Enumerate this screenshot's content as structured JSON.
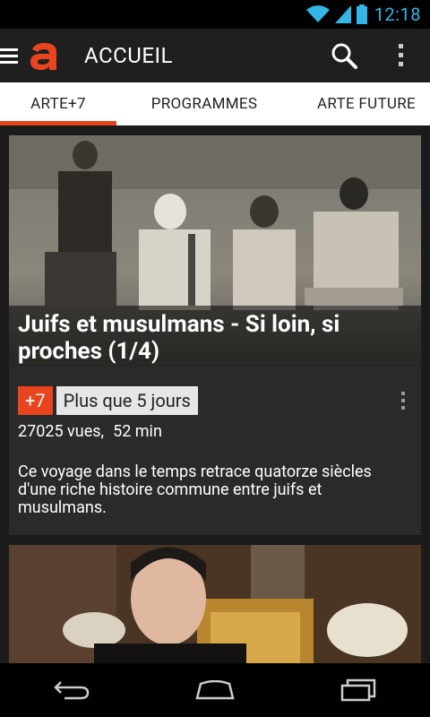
{
  "status": {
    "time": "12:18"
  },
  "appbar": {
    "title": "ACCUEIL",
    "logo_letter": "a"
  },
  "tabs": [
    {
      "label": "ARTE+7",
      "active": true
    },
    {
      "label": "PROGRAMMES",
      "active": false
    },
    {
      "label": "ARTE FUTURE",
      "active": false
    }
  ],
  "cards": [
    {
      "title": "Juifs et musulmans - Si loin, si proches  (1/4)",
      "badge": "+7",
      "availability": "Plus que 5 jours",
      "views": "27025 vues,",
      "duration": "52 min",
      "description": "Ce voyage dans le temps retrace quatorze siècles d'une riche histoire commune entre juifs et musulmans."
    }
  ],
  "colors": {
    "accent": "#e8451f",
    "status_blue": "#33b5e5",
    "card_bg": "#2a2a2a"
  }
}
